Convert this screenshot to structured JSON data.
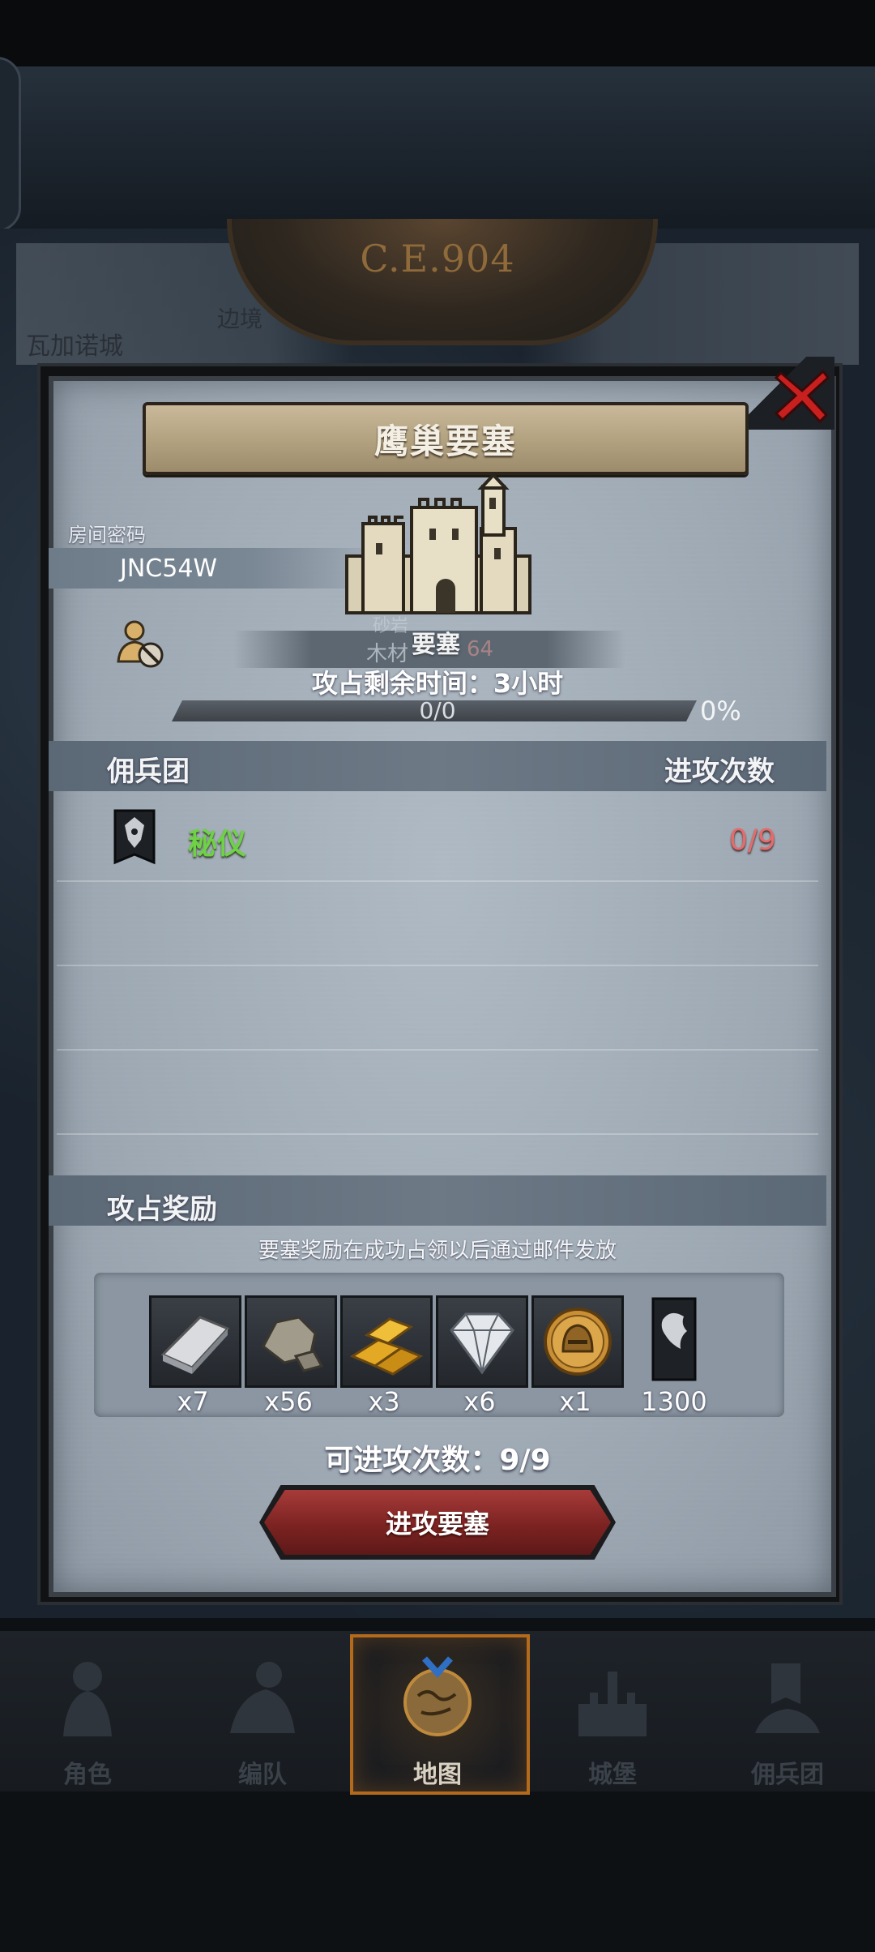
{
  "scene": {
    "era": "C.E.904",
    "city_label": "瓦加诺城",
    "bg_label": "边境"
  },
  "dialog": {
    "title": "鹰巢要塞",
    "room_code_label": "房间密码",
    "room_code": "JNC54W",
    "fortress_label": "要塞",
    "ghost_small": "砂岩",
    "ghost_wood": "木材",
    "ghost_wood_count": "64",
    "time_remaining": "攻占剩余时间：3小时",
    "progress": {
      "text": "0/0",
      "percent_label": "0%",
      "fraction": 0
    },
    "mercenary_header": "佣兵团",
    "attack_count_header": "进攻次数",
    "mercenaries": [
      {
        "name": "秘仪",
        "attacks": "0/9",
        "name_color": "#6fd146",
        "attacks_color": "#e56b6b"
      }
    ],
    "reward_header": "攻占奖励",
    "reward_note": "要塞奖励在成功占领以后通过邮件发放",
    "rewards": [
      {
        "icon": "iron-ingot-icon",
        "qty": "x7"
      },
      {
        "icon": "stone-ore-icon",
        "qty": "x56"
      },
      {
        "icon": "gold-bars-icon",
        "qty": "x3"
      },
      {
        "icon": "diamond-icon",
        "qty": "x6"
      },
      {
        "icon": "helmet-coin-icon",
        "qty": "x1"
      },
      {
        "icon": "mercenary-banner-icon",
        "qty": "1300"
      }
    ],
    "attack_count_label": "可进攻次数：9/9",
    "attack_button": "进攻要塞"
  },
  "nav": [
    {
      "label": "角色",
      "icon": "knight-icon"
    },
    {
      "label": "编队",
      "icon": "armored-rider-icon"
    },
    {
      "label": "地图",
      "icon": "map-globe-icon",
      "active": true
    },
    {
      "label": "城堡",
      "icon": "castle-icon"
    },
    {
      "label": "佣兵团",
      "icon": "banner-ship-icon"
    }
  ],
  "colors": {
    "accent_red": "#7c2322",
    "nav_active": "#b36a1c",
    "name_green": "#6fd146",
    "count_red": "#e56b6b"
  }
}
